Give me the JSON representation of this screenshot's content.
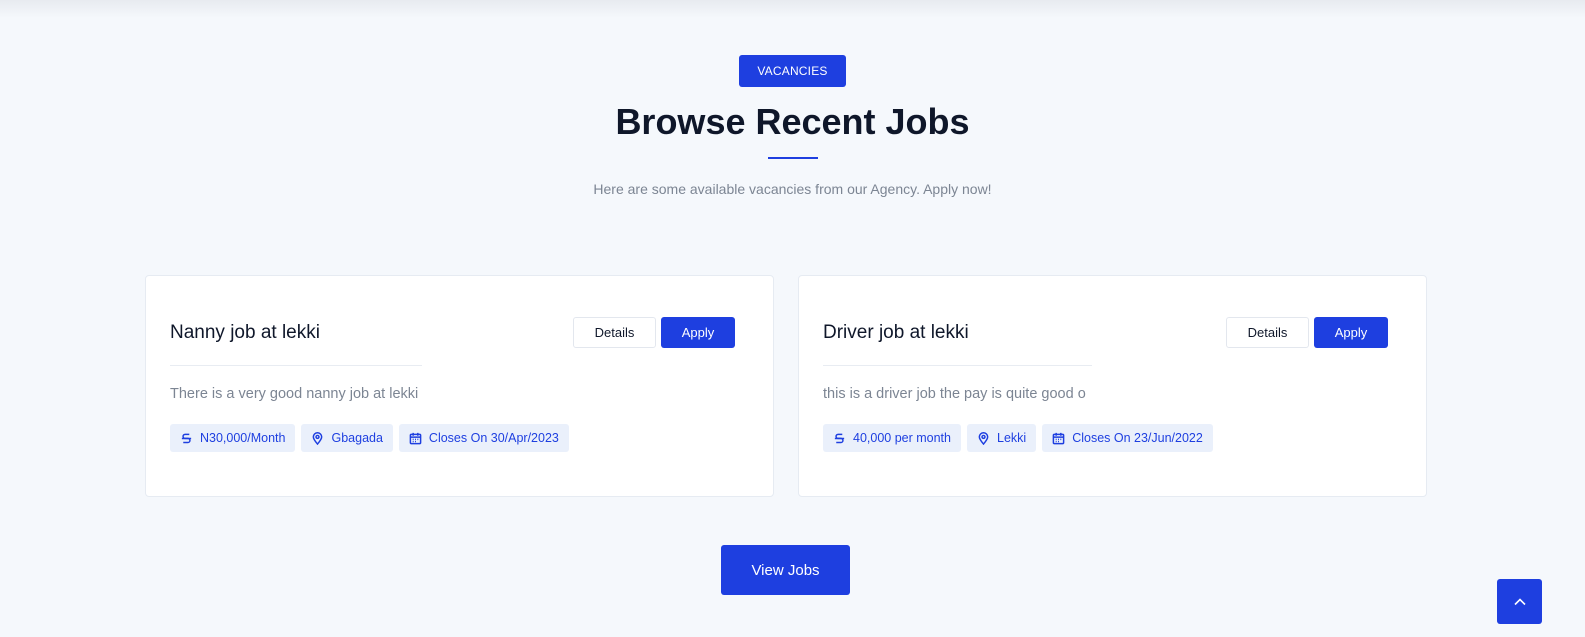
{
  "header": {
    "badge": "VACANCIES",
    "title": "Browse Recent Jobs",
    "subtitle": "Here are some available vacancies from our Agency. Apply now!"
  },
  "jobs": [
    {
      "title": "Nanny job at lekki",
      "details_label": "Details",
      "apply_label": "Apply",
      "description": "There is a very good nanny job at lekki",
      "salary": "N30,000/Month",
      "location": "Gbagada",
      "closing": "Closes On 30/Apr/2023"
    },
    {
      "title": "Driver job at lekki",
      "details_label": "Details",
      "apply_label": "Apply",
      "description": "this is a driver job the pay is quite good o",
      "salary": "40,000 per month",
      "location": "Lekki",
      "closing": "Closes On 23/Jun/2022"
    }
  ],
  "footer": {
    "view_jobs_label": "View Jobs"
  },
  "colors": {
    "accent": "#1e3fe0",
    "background": "#f5f8fc",
    "tag_bg": "#eaf0fb",
    "muted_text": "#7c8593"
  },
  "icons": {
    "salary": "currency-icon",
    "location": "map-pin-icon",
    "closing": "calendar-icon",
    "back_to_top": "chevron-up-icon"
  }
}
